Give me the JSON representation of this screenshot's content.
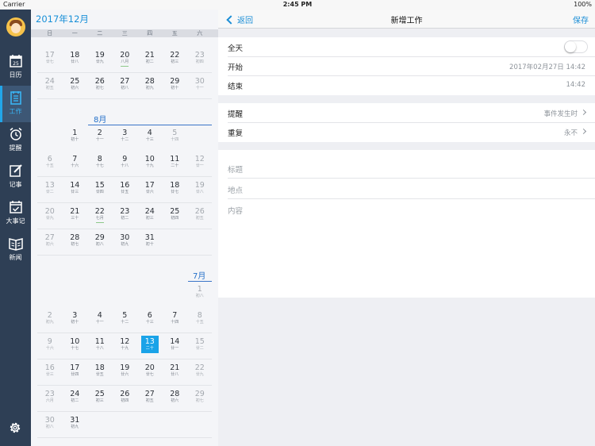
{
  "status_bar": {
    "carrier": "Carrier",
    "time": "2:45 PM",
    "battery": "100%"
  },
  "sidebar": {
    "items": [
      {
        "label": "日历",
        "icon": "calendar-icon",
        "badge": "25"
      },
      {
        "label": "工作",
        "icon": "work-list-icon"
      },
      {
        "label": "提醒",
        "icon": "alarm-clock-icon"
      },
      {
        "label": "记事",
        "icon": "note-edit-icon"
      },
      {
        "label": "大事记",
        "icon": "event-calendar-icon"
      },
      {
        "label": "新闻",
        "icon": "news-book-icon"
      }
    ],
    "active_index": 1,
    "settings_icon": "gear-icon"
  },
  "calendar": {
    "title": "2017年12月",
    "weekdays": [
      "日",
      "一",
      "二",
      "三",
      "四",
      "五",
      "六"
    ],
    "month_labels": {
      "aug": "8月",
      "jul": "7月"
    },
    "rows": [
      [
        {
          "n": "17",
          "l": "廿七",
          "g": true
        },
        {
          "n": "18",
          "l": "廿八"
        },
        {
          "n": "19",
          "l": "廿九"
        },
        {
          "n": "20",
          "l": "八月"
        },
        {
          "n": "21",
          "l": "初二"
        },
        {
          "n": "22",
          "l": "初三"
        },
        {
          "n": "23",
          "l": "初四",
          "g": true
        }
      ],
      [
        {
          "n": "24",
          "l": "初五",
          "g": true
        },
        {
          "n": "25",
          "l": "初六"
        },
        {
          "n": "26",
          "l": "初七"
        },
        {
          "n": "27",
          "l": "初八"
        },
        {
          "n": "28",
          "l": "初九"
        },
        {
          "n": "29",
          "l": "初十"
        },
        {
          "n": "30",
          "l": "十一",
          "g": true
        }
      ],
      [
        null,
        null,
        null,
        null,
        null,
        null,
        null
      ],
      [
        null,
        {
          "n": "1",
          "l": "初十"
        },
        {
          "n": "2",
          "l": "十一"
        },
        {
          "n": "3",
          "l": "十二"
        },
        {
          "n": "4",
          "l": "十三"
        },
        {
          "n": "5",
          "l": "十四",
          "g": true
        },
        null
      ],
      [
        {
          "n": "6",
          "l": "十五",
          "g": true
        },
        {
          "n": "7",
          "l": "十六"
        },
        {
          "n": "8",
          "l": "十七"
        },
        {
          "n": "9",
          "l": "十八"
        },
        {
          "n": "10",
          "l": "十九"
        },
        {
          "n": "11",
          "l": "二十"
        },
        {
          "n": "12",
          "l": "廿一",
          "g": true
        }
      ],
      [
        {
          "n": "13",
          "l": "廿二",
          "g": true
        },
        {
          "n": "14",
          "l": "廿三"
        },
        {
          "n": "15",
          "l": "廿四"
        },
        {
          "n": "16",
          "l": "廿五"
        },
        {
          "n": "17",
          "l": "廿六"
        },
        {
          "n": "18",
          "l": "廿七"
        },
        {
          "n": "19",
          "l": "廿八",
          "g": true
        }
      ],
      [
        {
          "n": "20",
          "l": "廿九",
          "g": true
        },
        {
          "n": "21",
          "l": "三十"
        },
        {
          "n": "22",
          "l": "七月"
        },
        {
          "n": "23",
          "l": "初二"
        },
        {
          "n": "24",
          "l": "初三"
        },
        {
          "n": "25",
          "l": "初四"
        },
        {
          "n": "26",
          "l": "初五",
          "g": true
        }
      ],
      [
        {
          "n": "27",
          "l": "初六",
          "g": true
        },
        {
          "n": "28",
          "l": "初七"
        },
        {
          "n": "29",
          "l": "初八"
        },
        {
          "n": "30",
          "l": "初九"
        },
        {
          "n": "31",
          "l": "初十"
        },
        null,
        null
      ],
      [
        null,
        null,
        null,
        null,
        null,
        null,
        {
          "n": "1",
          "l": "初八",
          "g": true
        }
      ],
      [
        {
          "n": "2",
          "l": "初九",
          "g": true
        },
        {
          "n": "3",
          "l": "初十"
        },
        {
          "n": "4",
          "l": "十一"
        },
        {
          "n": "5",
          "l": "十二"
        },
        {
          "n": "6",
          "l": "十三"
        },
        {
          "n": "7",
          "l": "十四"
        },
        {
          "n": "8",
          "l": "十五",
          "g": true
        }
      ],
      [
        {
          "n": "9",
          "l": "十六",
          "g": true
        },
        {
          "n": "10",
          "l": "十七"
        },
        {
          "n": "11",
          "l": "十八"
        },
        {
          "n": "12",
          "l": "十九"
        },
        {
          "n": "13",
          "l": "二十",
          "sel": true
        },
        {
          "n": "14",
          "l": "廿一"
        },
        {
          "n": "15",
          "l": "廿二",
          "g": true
        }
      ],
      [
        {
          "n": "16",
          "l": "廿三",
          "g": true
        },
        {
          "n": "17",
          "l": "廿四"
        },
        {
          "n": "18",
          "l": "廿五"
        },
        {
          "n": "19",
          "l": "廿六"
        },
        {
          "n": "20",
          "l": "廿七"
        },
        {
          "n": "21",
          "l": "廿八"
        },
        {
          "n": "22",
          "l": "廿九",
          "g": true
        }
      ],
      [
        {
          "n": "23",
          "l": "六月",
          "g": true
        },
        {
          "n": "24",
          "l": "初二"
        },
        {
          "n": "25",
          "l": "初三"
        },
        {
          "n": "26",
          "l": "初四"
        },
        {
          "n": "27",
          "l": "初五"
        },
        {
          "n": "28",
          "l": "初六"
        },
        {
          "n": "29",
          "l": "初七",
          "g": true
        }
      ],
      [
        {
          "n": "30",
          "l": "初八",
          "g": true
        },
        {
          "n": "31",
          "l": "初九"
        },
        null,
        null,
        null,
        null,
        null
      ]
    ]
  },
  "header": {
    "back": "返回",
    "title": "新增工作",
    "save": "保存"
  },
  "form": {
    "allday": {
      "label": "全天",
      "on": false
    },
    "start": {
      "label": "开始",
      "value": "2017年02月27日 14:42"
    },
    "end": {
      "label": "结束",
      "value": "14:42"
    },
    "remind": {
      "label": "提醒",
      "value": "事件发生时"
    },
    "repeat": {
      "label": "重复",
      "value": "永不"
    },
    "title_placeholder": "标题",
    "location_placeholder": "地点",
    "content_placeholder": "内容"
  },
  "colors": {
    "accent": "#1b8ed6",
    "sidebar": "#2e3f55",
    "selected": "#1aa3e8"
  }
}
